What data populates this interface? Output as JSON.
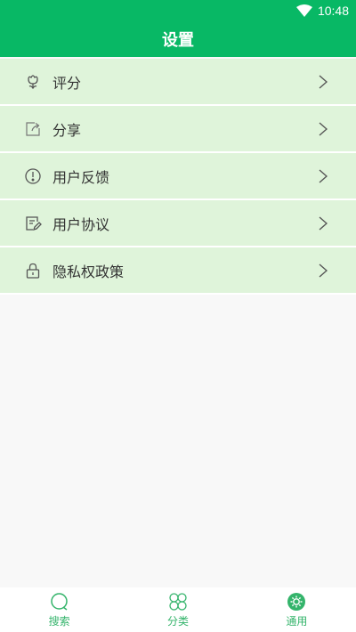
{
  "status_bar": {
    "time": "10:48",
    "wifi_icon": "wifi-icon"
  },
  "app_bar": {
    "title": "设置"
  },
  "settings": {
    "items": [
      {
        "label": "评分",
        "icon": "flower-icon"
      },
      {
        "label": "分享",
        "icon": "share-icon"
      },
      {
        "label": "用户反馈",
        "icon": "alert-circle-icon"
      },
      {
        "label": "用户协议",
        "icon": "document-edit-icon"
      },
      {
        "label": "隐私权政策",
        "icon": "lock-icon"
      }
    ]
  },
  "tabbar": {
    "tabs": [
      {
        "label": "搜索",
        "icon": "search-icon"
      },
      {
        "label": "分类",
        "icon": "category-icon"
      },
      {
        "label": "通用",
        "icon": "gear-icon",
        "active": true
      }
    ]
  },
  "colors": {
    "primary": "#08b865",
    "row_bg": "#dff4da",
    "tab_color": "#34b46b",
    "page_bg": "#f8f8f8"
  }
}
